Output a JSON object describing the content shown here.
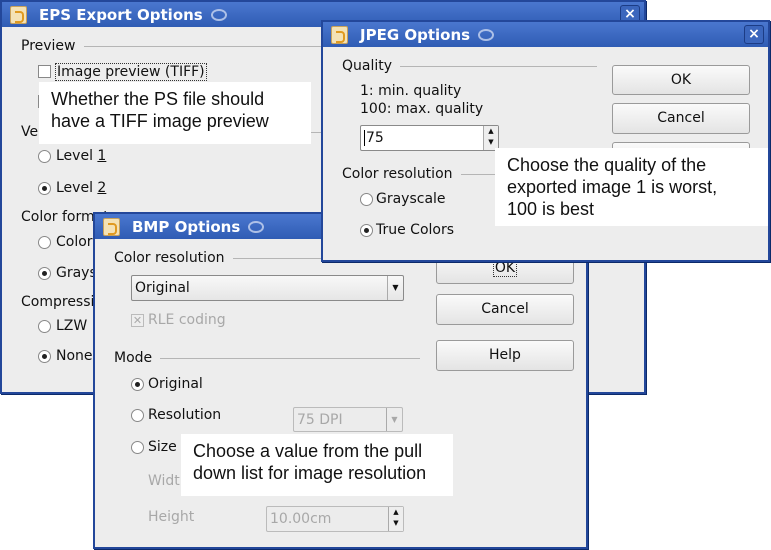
{
  "eps": {
    "title": "EPS Export Options",
    "close": "×",
    "preview_group": "Preview",
    "image_preview": "Image preview (TIFF)",
    "version_group": "Version",
    "level1": "Level ",
    "level1_num": "1",
    "level2": "Level ",
    "level2_num": "2",
    "color_format_group": "Color format",
    "color": "Color",
    "grayscale": "Grayscale",
    "compression_group": "Compression",
    "lzw": "LZW",
    "none": "None"
  },
  "jpeg": {
    "title": "JPEG Options",
    "close": "×",
    "quality_group": "Quality",
    "min_label": "1: min. quality",
    "max_label": "100: max. quality",
    "quality_value": "75",
    "color_resolution_group": "Color resolution",
    "grayscale": "Grayscale",
    "true_colors": "True Colors",
    "ok": "OK",
    "cancel": "Cancel"
  },
  "bmp": {
    "title": "BMP Options",
    "color_resolution_group": "Color resolution",
    "color_resolution_value": "Original",
    "rle_coding": "RLE coding",
    "mode_group": "Mode",
    "original": "Original",
    "resolution": "Resolution",
    "resolution_value": "75 DPI",
    "size": "Size",
    "width": "Width",
    "height": "Height",
    "height_value": "10.00cm",
    "ok": "OK",
    "cancel": "Cancel",
    "help": "Help"
  },
  "callouts": {
    "eps": [
      "Whether the PS file should",
      "have a TIFF image preview"
    ],
    "jpeg": [
      "Choose the quality of the",
      "exported image 1 is worst,",
      "100 is best"
    ],
    "bmp": [
      "Choose a value from the pull",
      "down list for image resolution"
    ]
  },
  "colors": {
    "titlebar": "#3a67c0",
    "window_bg": "#ededed",
    "border": "#23479a"
  }
}
